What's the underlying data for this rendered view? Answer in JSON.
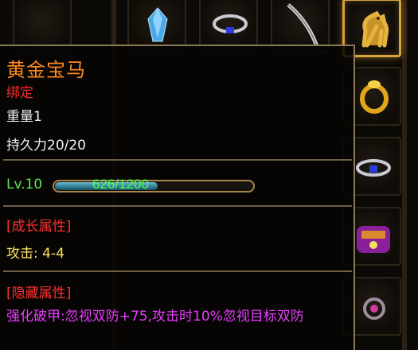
{
  "item": {
    "name": "黄金宝马",
    "binding": "绑定",
    "weight": "重量1",
    "durability": "持久力20/20",
    "level": "Lv.10",
    "exp_text": "626/1200",
    "exp_fraction": 0.52,
    "growth_header": "[成长属性]",
    "attack": "攻击: 4-4",
    "hidden_header": "[隐藏属性]",
    "hidden_desc": "强化破甲:忽视双防+75,攻击时10%忽视目标双防"
  },
  "colors": {
    "name": "#ff8a1e",
    "binding": "#ff2b2b",
    "level": "#5ee35e",
    "attack": "#ffe45a",
    "hidden_desc": "#e83cff",
    "selected_slot_border": "#d9a23a"
  },
  "icons": [
    "crystal-icon",
    "ring-icon",
    "sword-icon",
    "golden-horse-icon",
    "gold-ring-icon",
    "gem-pouch-icon",
    "amulet-icon",
    "gauntlet-icon"
  ]
}
